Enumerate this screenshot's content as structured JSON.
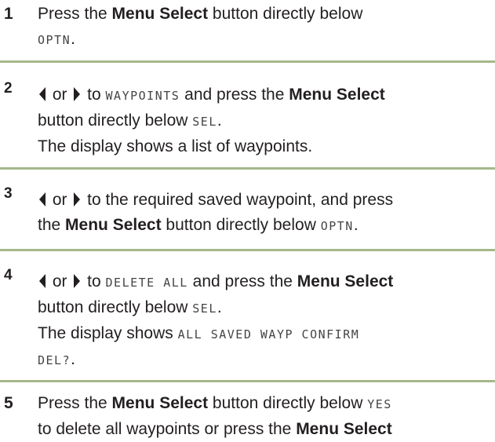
{
  "steps": [
    {
      "num": "1",
      "a": "Press the ",
      "b1": "Menu Select",
      "c": " button directly below",
      "lcd1": "OPTN",
      "d": "."
    },
    {
      "num": "2",
      "or": " or ",
      "to": " to ",
      "lcd1": "WAYPOINTS",
      "and": " and press the ",
      "b1": "Menu Select",
      "e": "button directly below ",
      "lcd2": "SEL",
      "f": ".",
      "g": "The display shows a list of waypoints."
    },
    {
      "num": "3",
      "or": " or ",
      "a": " to the required saved waypoint, and press",
      "the": "the ",
      "b1": "Menu Select",
      "c": " button directly below ",
      "lcd1": "OPTN",
      "d": "."
    },
    {
      "num": "4",
      "or": " or ",
      "to": " to ",
      "lcd1": "DELETE ALL",
      "and": " and press the ",
      "b1": "Menu Select",
      "e": "button directly below ",
      "lcd2": "SEL",
      "f": ".",
      "g": "The display shows ",
      "lcd3": "ALL SAVED WAYP CONFIRM",
      "lcd4": "DEL?",
      "h": "."
    },
    {
      "num": "5",
      "a": "Press the ",
      "b1": "Menu Select",
      "c": " button directly below ",
      "lcd1": "YES",
      "e": "to delete all waypoints or press the ",
      "b2": "Menu Select"
    }
  ]
}
